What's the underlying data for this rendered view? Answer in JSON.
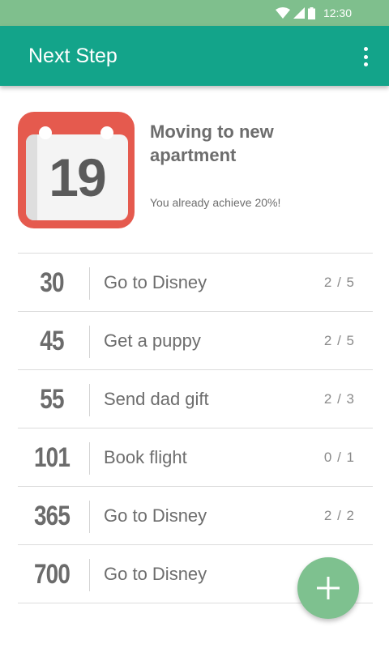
{
  "status_bar": {
    "time": "12:30",
    "icons": [
      "wifi-icon",
      "signal-icon",
      "battery-icon"
    ]
  },
  "app_bar": {
    "title": "Next Step",
    "menu_icon": "more-vert-icon"
  },
  "goal": {
    "calendar_day": "19",
    "title": "Moving to new apartment",
    "progress_text": "You already achieve 20%!"
  },
  "tasks": [
    {
      "days": "30",
      "name": "Go to Disney",
      "count": "2 / 5"
    },
    {
      "days": "45",
      "name": "Get a puppy",
      "count": "2 / 5"
    },
    {
      "days": "55",
      "name": "Send dad gift",
      "count": "2 / 3"
    },
    {
      "days": "101",
      "name": "Book flight",
      "count": "0 / 1"
    },
    {
      "days": "365",
      "name": "Go to Disney",
      "count": "2 / 2"
    },
    {
      "days": "700",
      "name": "Go to Disney",
      "count": ""
    }
  ],
  "fab": {
    "icon": "add-icon"
  },
  "colors": {
    "status_bar": "#7fbf8d",
    "app_bar": "#13a48a",
    "calendar": "#e55a4e",
    "fab": "#7ec18f",
    "text": "#6d6d6d"
  }
}
